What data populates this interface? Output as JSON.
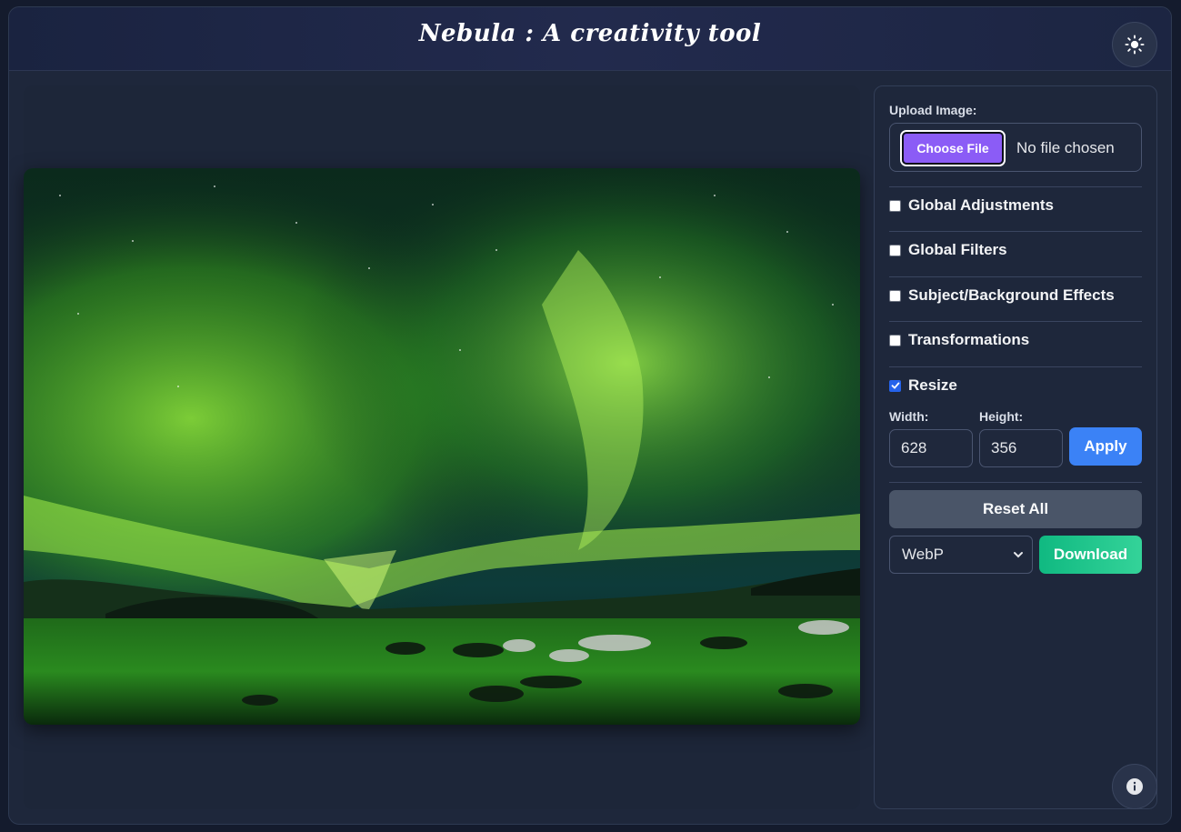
{
  "header": {
    "title": "Nebula : A creativity tool",
    "theme_toggle_icon": "sun-icon"
  },
  "canvas": {
    "image_description_icon": "aurora-photo"
  },
  "panel": {
    "upload_label": "Upload Image:",
    "choose_file_label": "Choose File",
    "file_status": "No file chosen",
    "sections": [
      {
        "label": "Global Adjustments",
        "checked": false
      },
      {
        "label": "Global Filters",
        "checked": false
      },
      {
        "label": "Subject/Background Effects",
        "checked": false
      },
      {
        "label": "Transformations",
        "checked": false
      },
      {
        "label": "Resize",
        "checked": true
      }
    ],
    "resize": {
      "width_label": "Width:",
      "height_label": "Height:",
      "width_value": "628",
      "height_value": "356",
      "apply_label": "Apply"
    },
    "reset_label": "Reset All",
    "format_selected": "WebP",
    "download_label": "Download"
  },
  "info_icon": "info-icon",
  "colors": {
    "accent_purple": "#8b5cf6",
    "apply_blue": "#3b82f6",
    "download_green": "#10b981",
    "reset_gray": "#4a5568"
  }
}
